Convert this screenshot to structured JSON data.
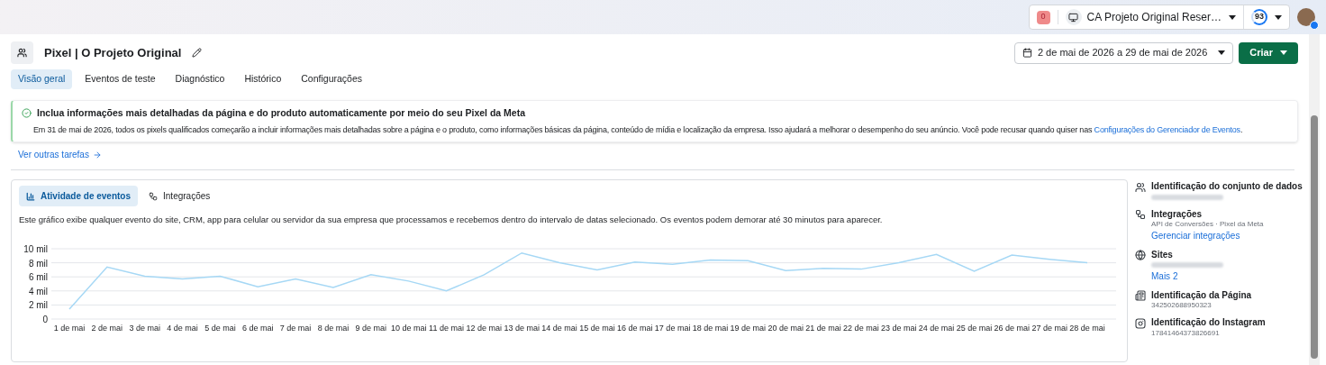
{
  "topbar": {
    "alert_badge": "0",
    "account": "CA Projeto Original Reser…",
    "score": "93"
  },
  "header": {
    "title": "Pixel | O Projeto Original",
    "date_range": "2 de mai de 2026 a 29 de mai de 2026",
    "create_button": "Criar"
  },
  "tabs": [
    {
      "label": "Visão geral",
      "selected": true
    },
    {
      "label": "Eventos de teste",
      "selected": false
    },
    {
      "label": "Diagnóstico",
      "selected": false
    },
    {
      "label": "Histórico",
      "selected": false
    },
    {
      "label": "Configurações",
      "selected": false
    }
  ],
  "notice": {
    "title": "Inclua informações mais detalhadas da página e do produto automaticamente por meio do seu Pixel da Meta",
    "body": "Em 31 de mai de 2026, todos os pixels qualificados começarão a incluir informações mais detalhadas sobre a página e o produto, como informações básicas da página, conteúdo de mídia e localização da empresa. Isso ajudará a melhorar o desempenho do seu anúncio. Você pode recusar quando quiser nas",
    "link": "Configurações do Gerenciador de Eventos",
    "tail": ".",
    "more_link": "Ver outras tarefas"
  },
  "activity": {
    "tabs": [
      {
        "label": "Atividade de eventos",
        "selected": true,
        "kind": "chart"
      },
      {
        "label": "Integrações",
        "selected": false,
        "kind": "integrations"
      }
    ],
    "description": "Este gráfico exibe qualquer evento do site, CRM, app para celular ou servidor da sua empresa que processamos e recebemos dentro do intervalo de datas selecionado. Os eventos podem demorar até 30 minutos para aparecer.",
    "chart_data": {
      "type": "line",
      "categories": [
        "1 de mai",
        "2 de mai",
        "3 de mai",
        "4 de mai",
        "5 de mai",
        "6 de mai",
        "7 de mai",
        "8 de mai",
        "9 de mai",
        "10 de mai",
        "11 de mai",
        "12 de mai",
        "13 de mai",
        "14 de mai",
        "15 de mai",
        "16 de mai",
        "17 de mai",
        "18 de mai",
        "19 de mai",
        "20 de mai",
        "21 de mai",
        "22 de mai",
        "23 de mai",
        "24 de mai",
        "25 de mai",
        "26 de mai",
        "27 de mai",
        "28 de mai"
      ],
      "series": [
        {
          "color": "#a6d8f5",
          "values": [
            1.4,
            7.4,
            6.1,
            5.7,
            6.1,
            4.6,
            5.7,
            4.5,
            6.3,
            5.4,
            4.0,
            6.3,
            9.4,
            8.0,
            7.0,
            8.1,
            7.8,
            8.4,
            8.3,
            6.9,
            7.2,
            7.1,
            8.0,
            9.2,
            6.8,
            9.1,
            8.5,
            8.0
          ]
        }
      ],
      "ylim": [
        0,
        10
      ],
      "grid": true,
      "yticks": [
        {
          "value": 0,
          "label": "0"
        },
        {
          "value": 2,
          "label": "2 mil"
        },
        {
          "value": 4,
          "label": "4 mil"
        },
        {
          "value": 6,
          "label": "6 mil"
        },
        {
          "value": 8,
          "label": "8 mil"
        },
        {
          "value": 10,
          "label": "10 mil"
        }
      ]
    }
  },
  "details": [
    {
      "kind": "dataset",
      "title": "Identificação do conjunto de dados",
      "redacted": true
    },
    {
      "kind": "integrations",
      "title": "Integrações",
      "subtitle": "API de Conversões · Pixel da Meta",
      "link": "Gerenciar integrações"
    },
    {
      "kind": "sites",
      "title": "Sites",
      "redacted": true,
      "link": "Mais 2"
    },
    {
      "kind": "page",
      "title": "Identificação da Página",
      "subtitle": "342502688950323"
    },
    {
      "kind": "instagram",
      "title": "Identificação do Instagram",
      "subtitle": "17841464373826691"
    }
  ]
}
